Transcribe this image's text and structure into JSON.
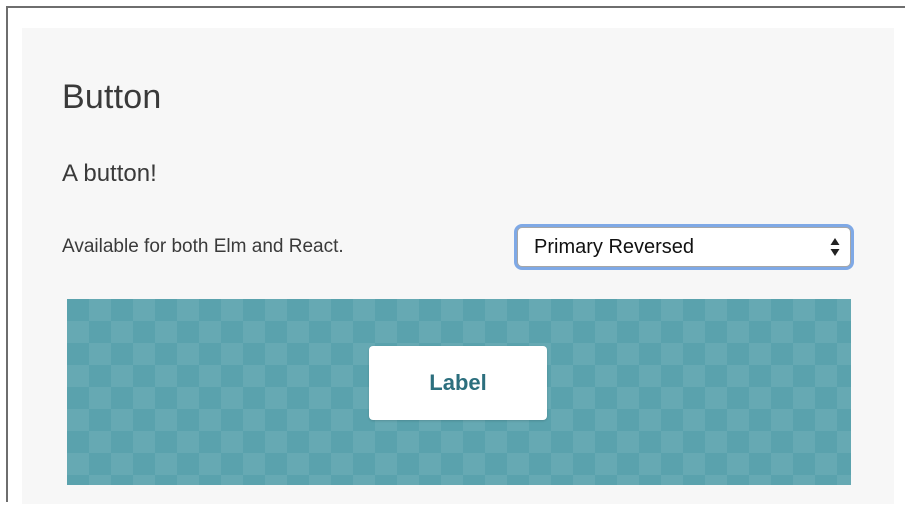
{
  "header": {
    "title": "Button",
    "description": "A button!"
  },
  "availability": {
    "text": "Available for both Elm and React."
  },
  "style_select": {
    "selected": "Primary Reversed",
    "icon": "up-down-arrows-icon"
  },
  "preview": {
    "background_color": "#5aa2ad",
    "button_label": "Label",
    "button_text_color": "#2c6f7e"
  }
}
